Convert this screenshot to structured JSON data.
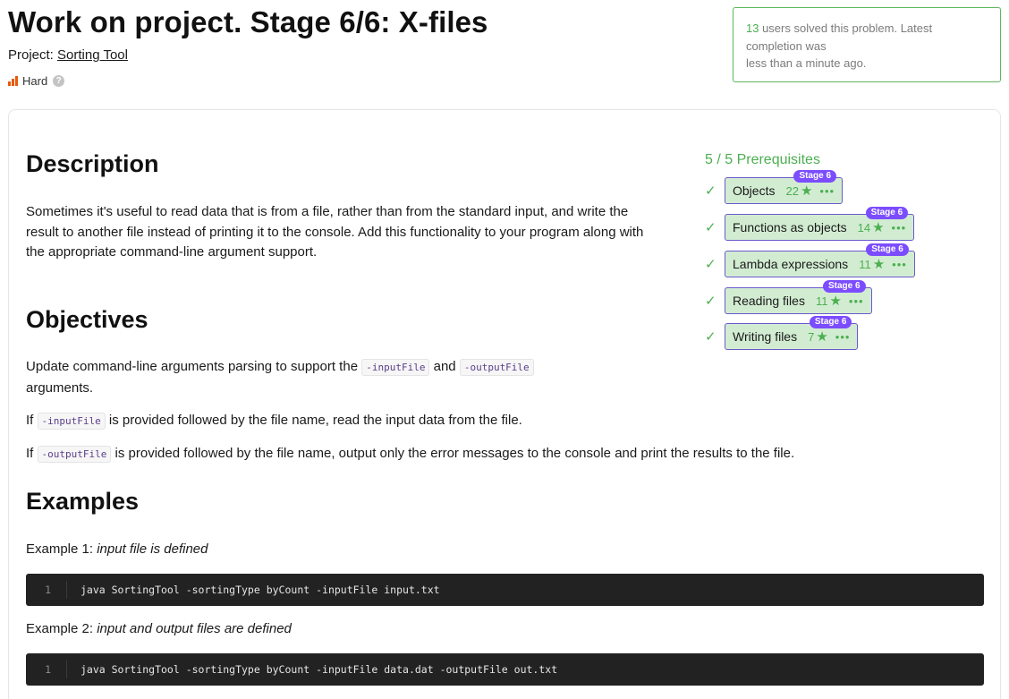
{
  "header": {
    "title": "Work on project. Stage 6/6: X-files",
    "project_label": "Project:",
    "project_name": "Sorting Tool",
    "difficulty": "Hard",
    "help": "?"
  },
  "solved": {
    "count": "13",
    "text_after_count": " users solved this problem. Latest completion was",
    "time": "less than a minute ago."
  },
  "description": {
    "heading": "Description",
    "text": "Sometimes it's useful to read data that is from a file, rather than from the standard input, and write the result to another file instead of printing it to the console. Add this functionality to your program along with the appropriate command-line argument support."
  },
  "objectives": {
    "heading": "Objectives",
    "p1_a": "Update command-line arguments parsing to support the ",
    "code_input": "-inputFile",
    "p1_b": " and ",
    "code_output": "-outputFile",
    "p1_c": "arguments.",
    "p2_a": "If ",
    "p2_b": " is provided followed by the file name, read the input data from the file.",
    "p3_a": "If ",
    "p3_b": " is provided followed by the file name, output only the error messages to the console and print the results to the file."
  },
  "examples": {
    "heading": "Examples",
    "ex1_label": "Example 1: ",
    "ex1_desc": "input file is defined",
    "ex1_line": "1",
    "ex1_code": "java SortingTool -sortingType byCount -inputFile input.txt",
    "ex2_label": "Example 2: ",
    "ex2_desc": "input and output files are defined",
    "ex2_line": "1",
    "ex2_code": "java SortingTool -sortingType byCount -inputFile data.dat -outputFile out.txt"
  },
  "prerequisites": {
    "title": "5 / 5 Prerequisites",
    "items": [
      {
        "label": "Objects",
        "rating": "22",
        "stage": "Stage 6"
      },
      {
        "label": "Functions as objects",
        "rating": "14",
        "stage": "Stage 6"
      },
      {
        "label": "Lambda expressions",
        "rating": "11",
        "stage": "Stage 6"
      },
      {
        "label": "Reading files",
        "rating": "11",
        "stage": "Stage 6"
      },
      {
        "label": "Writing files",
        "rating": "7",
        "stage": "Stage 6"
      }
    ]
  },
  "colors": {
    "accent_green": "#4caf50",
    "badge_purple": "#7c4dff",
    "difficulty_orange": "#e8590c"
  }
}
